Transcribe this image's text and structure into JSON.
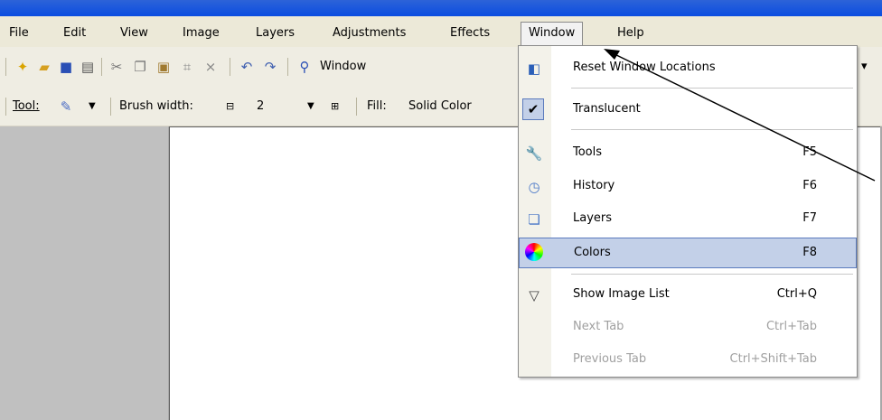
{
  "menubar": {
    "items": [
      {
        "label": "File"
      },
      {
        "label": "Edit"
      },
      {
        "label": "View"
      },
      {
        "label": "Image"
      },
      {
        "label": "Layers"
      },
      {
        "label": "Adjustments"
      },
      {
        "label": "Effects"
      },
      {
        "label": "Window"
      },
      {
        "label": "Help"
      }
    ]
  },
  "toolbar1": {
    "zoom_label": "Window",
    "icons": [
      "new-icon",
      "open-icon",
      "save-icon",
      "print-icon",
      "cut-icon",
      "copy-icon",
      "paste-icon",
      "crop-icon",
      "deselect-icon",
      "undo-icon",
      "redo-icon",
      "zoom-icon"
    ]
  },
  "toolbar2": {
    "tool_label": "Tool:",
    "brush_width_label": "Brush width:",
    "brush_width_value": "2",
    "fill_label": "Fill:",
    "fill_value": "Solid Color"
  },
  "window_menu": {
    "items": [
      {
        "label": "Reset Window Locations",
        "shortcut": "",
        "icon": "reset-window-icon",
        "enabled": true,
        "highlighted": false
      },
      {
        "label": "Translucent",
        "shortcut": "",
        "icon": "checkmark-icon",
        "enabled": true,
        "highlighted": false,
        "checked": true
      },
      {
        "label": "Tools",
        "shortcut": "F5",
        "icon": "tools-icon",
        "enabled": true,
        "highlighted": false
      },
      {
        "label": "History",
        "shortcut": "F6",
        "icon": "history-icon",
        "enabled": true,
        "highlighted": false
      },
      {
        "label": "Layers",
        "shortcut": "F7",
        "icon": "layers-icon",
        "enabled": true,
        "highlighted": false
      },
      {
        "label": "Colors",
        "shortcut": "F8",
        "icon": "colors-icon",
        "enabled": true,
        "highlighted": true
      },
      {
        "label": "Show Image List",
        "shortcut": "Ctrl+Q",
        "icon": "image-list-icon",
        "enabled": true,
        "highlighted": false
      },
      {
        "label": "Next Tab",
        "shortcut": "Ctrl+Tab",
        "icon": "",
        "enabled": false,
        "highlighted": false
      },
      {
        "label": "Previous Tab",
        "shortcut": "Ctrl+Shift+Tab",
        "icon": "",
        "enabled": false,
        "highlighted": false
      }
    ]
  },
  "colors": {
    "titlebar": "#0b4de0",
    "menubar": "#ece9d8",
    "highlight": "#c3d0e8",
    "highlight_border": "#5b7bbd",
    "workspace": "#c0c0c0"
  }
}
